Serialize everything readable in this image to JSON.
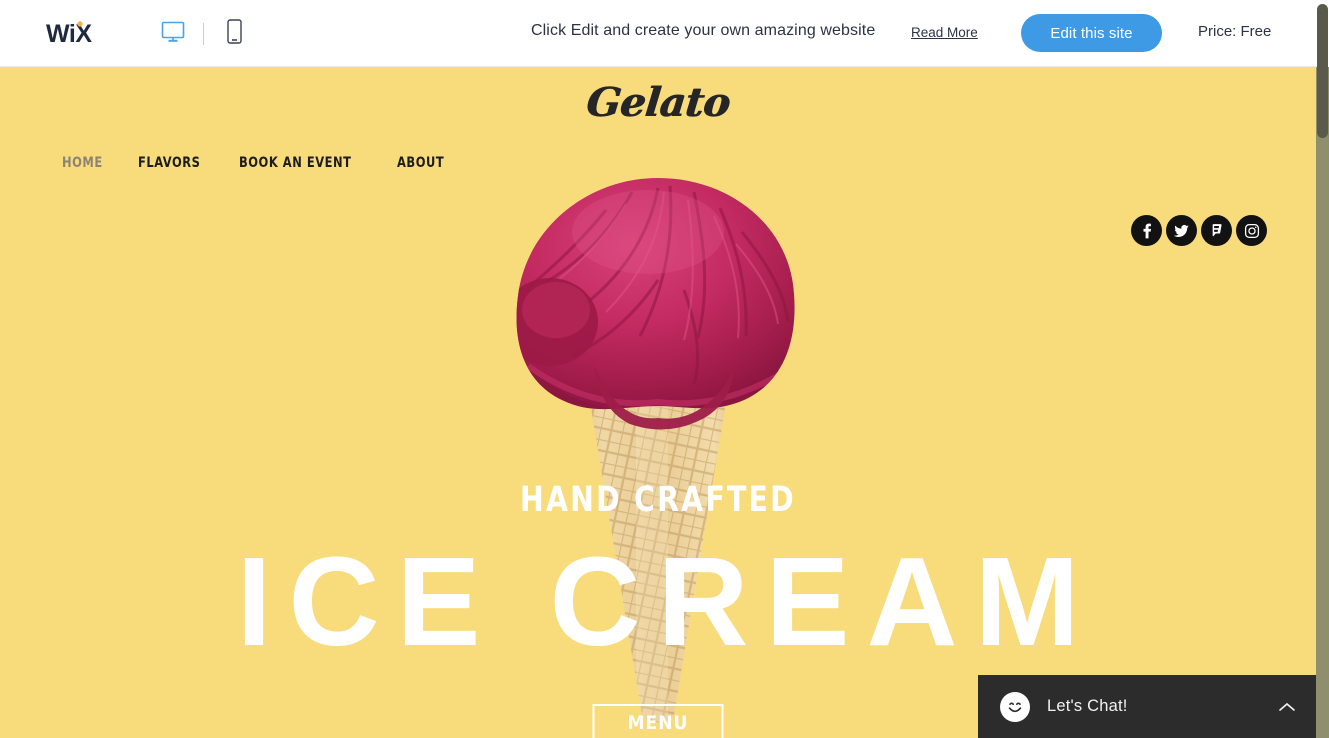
{
  "editor_bar": {
    "logo_name": "wix-logo",
    "logo_text": "WiX",
    "viewport": {
      "desktop_icon": "desktop-monitor-icon",
      "mobile_icon": "mobile-phone-icon",
      "active": "desktop"
    },
    "promo_text": "Click Edit and create your own amazing website",
    "read_more_label": "Read More",
    "edit_site_label": "Edit this site",
    "price_label": "Price: Free",
    "accent_color": "#3f9ae5",
    "logo_color": "#1f2b3d",
    "logo_dot_color": "#f3b347",
    "text_color": "#2b3445"
  },
  "site": {
    "background_color": "#f8dc7c",
    "logo_text": "Gelato",
    "logo_color": "#262626",
    "nav": [
      {
        "label": "HOME",
        "active": true
      },
      {
        "label": "FLAVORS",
        "active": false
      },
      {
        "label": "BOOK AN EVENT",
        "active": false
      },
      {
        "label": "ABOUT",
        "active": false
      }
    ],
    "social": [
      {
        "name": "facebook-icon",
        "title": "Facebook"
      },
      {
        "name": "twitter-icon",
        "title": "Twitter"
      },
      {
        "name": "foursquare-icon",
        "title": "Foursquare"
      },
      {
        "name": "instagram-icon",
        "title": "Instagram"
      }
    ],
    "social_bg_color": "#121212",
    "hero": {
      "subtitle": "HAND CRAFTED",
      "title": "ICE CREAM",
      "text_color": "#ffffff",
      "cta_label": "MENU"
    },
    "artwork": {
      "name": "ice-cream-cone-photo",
      "scoop_color": "#c02a5e",
      "cone_color": "#e8c98c"
    }
  },
  "chat": {
    "label": "Let's Chat!",
    "avatar_icon": "smiley-face-icon",
    "collapse_icon": "chevron-up-icon",
    "background_color": "#2c2c2c",
    "text_color": "#f2f2f2"
  },
  "scrollbar": {
    "name": "page-scrollbar",
    "thumb_color": "#5a5a4a",
    "track_color": "#8f8f6e"
  }
}
